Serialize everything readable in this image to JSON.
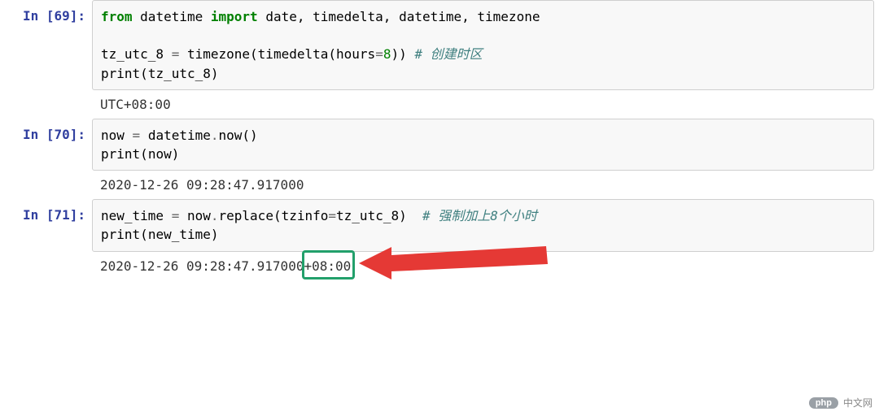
{
  "cells": [
    {
      "prompt": "In [69]:",
      "input": {
        "l1": {
          "kw_from": "from",
          "mod": "datetime",
          "kw_import": "import",
          "names": "date, timedelta, datetime, timezone"
        },
        "l3": {
          "lhs": "tz_utc_8",
          "eq": " = ",
          "fn1": "timezone",
          "paren1": "(",
          "fn2": "timedelta",
          "paren2": "(",
          "param": "hours",
          "eq2": "=",
          "num": "8",
          "close": "))",
          "sp": " ",
          "comment": "# 创建时区"
        },
        "l4": {
          "pr": "print",
          "open": "(",
          "arg": "tz_utc_8",
          "close": ")"
        }
      },
      "output": "UTC+08:00"
    },
    {
      "prompt": "In [70]:",
      "input": {
        "l1": {
          "lhs": "now",
          "eq": " = ",
          "obj": "datetime",
          "dot": ".",
          "meth": "now",
          "parens": "()"
        },
        "l2": {
          "pr": "print",
          "open": "(",
          "arg": "now",
          "close": ")"
        }
      },
      "output": "2020-12-26 09:28:47.917000"
    },
    {
      "prompt": "In [71]:",
      "input": {
        "l1": {
          "lhs": "new_time",
          "eq": " = ",
          "obj": "now",
          "dot": ".",
          "meth": "replace",
          "open": "(",
          "param": "tzinfo",
          "eq2": "=",
          "arg": "tz_utc_8",
          "close": ")",
          "sp": "  ",
          "comment": "# 强制加上8个小时"
        },
        "l2": {
          "pr": "print",
          "open": "(",
          "arg": "new_time",
          "close": ")"
        }
      },
      "output_prefix": "2020-12-26 09:28:47.917000",
      "output_highlight": "+08:00"
    }
  ],
  "footer": {
    "badge": "php",
    "site": "中文网"
  }
}
